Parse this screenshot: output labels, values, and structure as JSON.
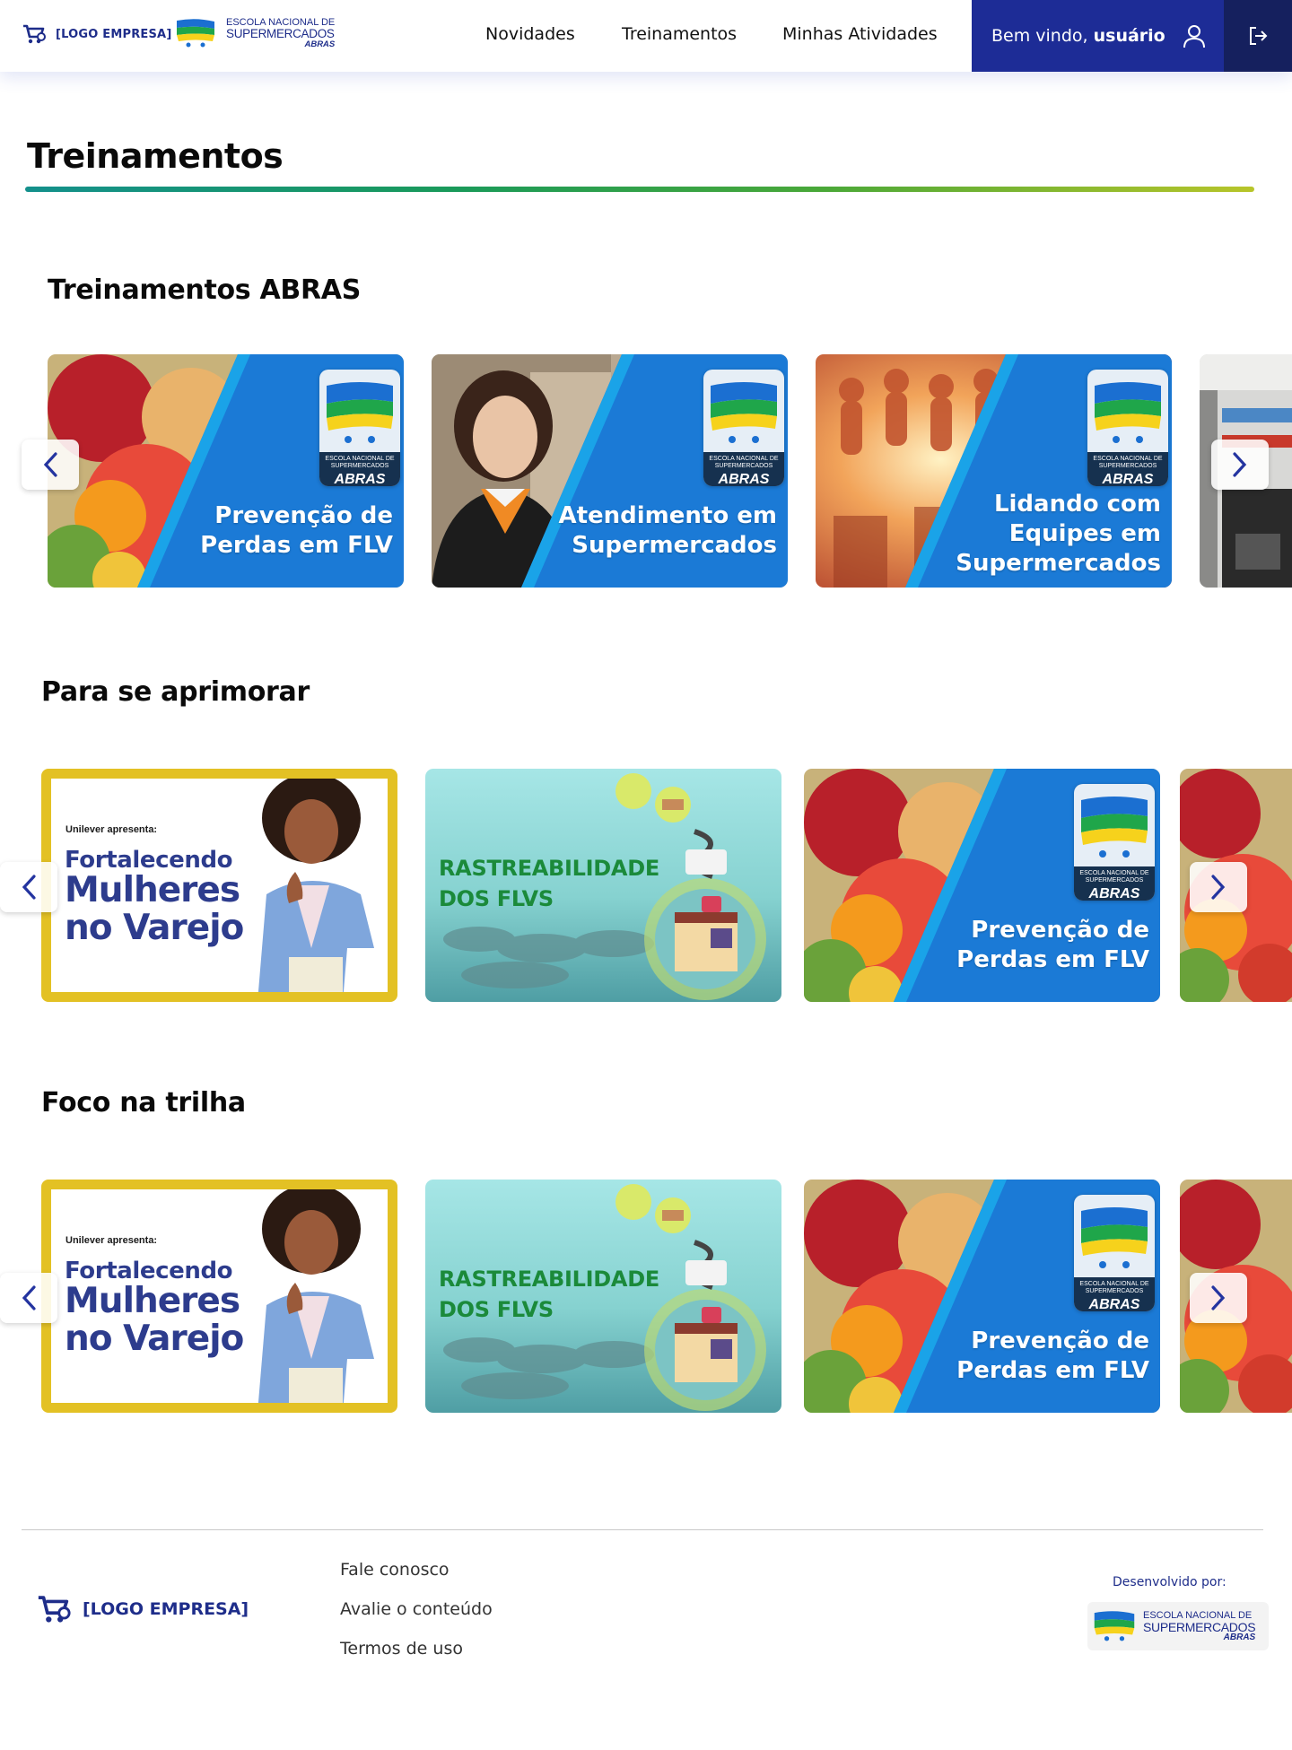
{
  "header": {
    "company_logo_text": "[LOGO EMPRESA]",
    "school_logo": {
      "line1": "ESCOLA NACIONAL DE",
      "line2": "SUPERMERCADOS",
      "line3": "ABRAS"
    },
    "nav": [
      "Novidades",
      "Treinamentos",
      "Minhas Atividades"
    ],
    "welcome_prefix": "Bem vindo, ",
    "username": "usuário",
    "icons": {
      "user": "user-icon",
      "logout": "logout-icon",
      "cart": "cart-icon"
    },
    "colors": {
      "welcome_bg": "#1d2c96",
      "logout_bg": "#15205e"
    }
  },
  "page": {
    "title": "Treinamentos"
  },
  "sections": [
    {
      "title": "Treinamentos ABRAS",
      "cards": [
        {
          "title": "Prevenção de\nPerdas em FLV",
          "badge": {
            "line1": "ESCOLA NACIONAL DE",
            "line2": "SUPERMERCADOS",
            "line3": "ABRAS"
          }
        },
        {
          "title": "Atendimento em\nSupermercados",
          "badge": {
            "line1": "ESCOLA NACIONAL DE",
            "line2": "SUPERMERCADOS",
            "line3": "ABRAS"
          }
        },
        {
          "title": "Lidando com\nEquipes em\nSupermercados",
          "badge": {
            "line1": "ESCOLA NACIONAL DE",
            "line2": "SUPERMERCADOS",
            "line3": "ABRAS"
          }
        }
      ]
    },
    {
      "title": "Para se aprimorar",
      "cards": [
        {
          "intro": "Unilever apresenta:",
          "line1": "Fortalecendo",
          "line2": "Mulheres\nno Varejo"
        },
        {
          "title": "RASTREABILIDADE\nDOS FLVS"
        },
        {
          "title": "Prevenção de\nPerdas em FLV",
          "badge": {
            "line1": "ESCOLA NACIONAL DE",
            "line2": "SUPERMERCADOS",
            "line3": "ABRAS"
          }
        }
      ]
    },
    {
      "title": "Foco na trilha",
      "cards": [
        {
          "intro": "Unilever apresenta:",
          "line1": "Fortalecendo",
          "line2": "Mulheres\nno Varejo"
        },
        {
          "title": "RASTREABILIDADE\nDOS FLVS"
        },
        {
          "title": "Prevenção de\nPerdas em FLV",
          "badge": {
            "line1": "ESCOLA NACIONAL DE",
            "line2": "SUPERMERCADOS",
            "line3": "ABRAS"
          }
        }
      ]
    }
  ],
  "footer": {
    "company_logo_text": "[LOGO EMPRESA]",
    "links": [
      "Fale conosco",
      "Avalie o conteúdo",
      "Termos de uso"
    ],
    "developed_by": "Desenvolvido por:",
    "school_logo": {
      "line1": "ESCOLA NACIONAL DE",
      "line2": "SUPERMERCADOS",
      "line3": "ABRAS"
    }
  }
}
